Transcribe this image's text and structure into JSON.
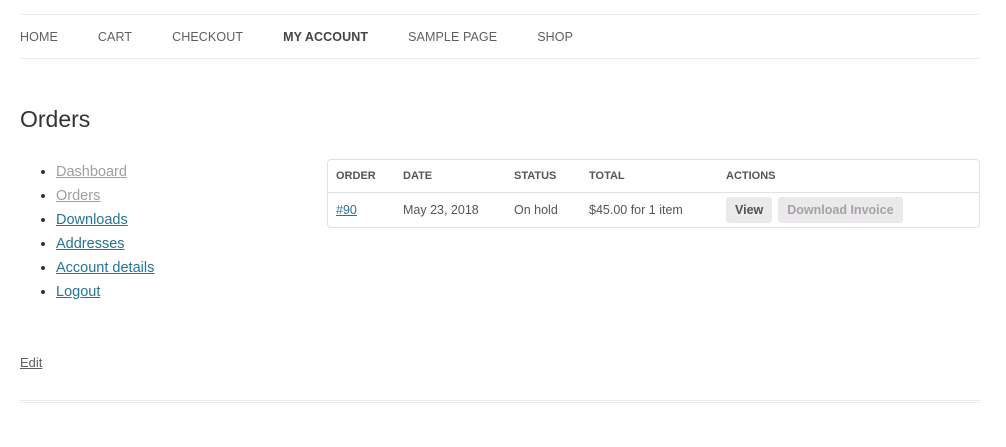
{
  "nav": {
    "items": [
      {
        "label": "HOME",
        "active": false
      },
      {
        "label": "CART",
        "active": false
      },
      {
        "label": "CHECKOUT",
        "active": false
      },
      {
        "label": "MY ACCOUNT",
        "active": true
      },
      {
        "label": "SAMPLE PAGE",
        "active": false
      },
      {
        "label": "SHOP",
        "active": false
      }
    ]
  },
  "page": {
    "title": "Orders"
  },
  "account_nav": {
    "items": [
      {
        "label": "Dashboard",
        "muted": true
      },
      {
        "label": "Orders",
        "muted": true
      },
      {
        "label": "Downloads",
        "muted": false
      },
      {
        "label": "Addresses",
        "muted": false
      },
      {
        "label": "Account details",
        "muted": false
      },
      {
        "label": "Logout",
        "muted": false
      }
    ]
  },
  "orders": {
    "columns": [
      "ORDER",
      "DATE",
      "STATUS",
      "TOTAL",
      "ACTIONS"
    ],
    "rows": [
      {
        "order": "#90",
        "date": "May 23, 2018",
        "status": "On hold",
        "total": "$45.00 for 1 item",
        "actions": {
          "view": "View",
          "invoice": "Download Invoice"
        }
      }
    ]
  },
  "footer": {
    "edit_label": "Edit"
  },
  "colors": {
    "link": "#21759b",
    "muted_link": "#9f9f9f",
    "button_bg": "#ebe9eb",
    "border": "#e1e1e1"
  }
}
